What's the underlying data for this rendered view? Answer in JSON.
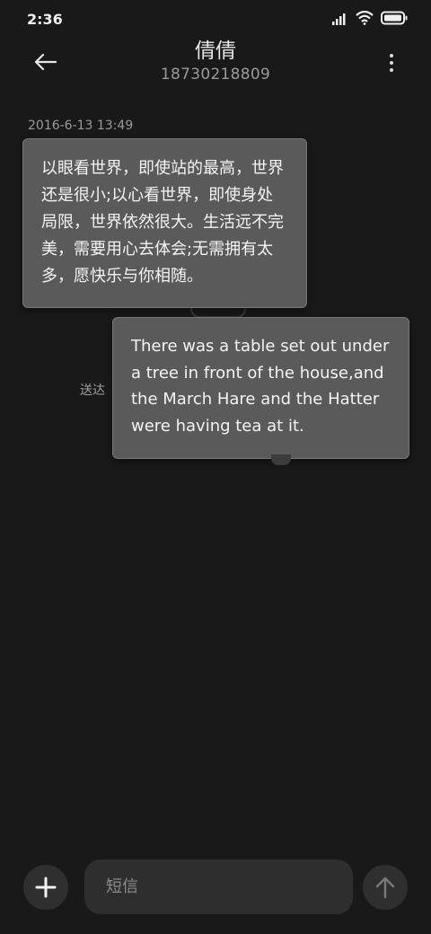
{
  "status_bar": {
    "time": "2:36",
    "icons": [
      "signal-icon",
      "wifi-icon",
      "battery-icon"
    ]
  },
  "header": {
    "contact_name": "倩倩",
    "contact_phone": "18730218809",
    "back_icon": "arrow-left-icon",
    "more_icon": "more-vertical-icon"
  },
  "conversation": {
    "timestamp": "2016-6-13 13:49",
    "messages": [
      {
        "direction": "incoming",
        "text": "以眼看世界，即使站的最高，世界还是很小;以心看世界，即使身处局限，世界依然很大。生活远不完美，需要用心去体会;无需拥有太多，愿快乐与你相随。"
      },
      {
        "direction": "outgoing",
        "text": "There was a table set out under a tree in front of the house,and the March Hare and the Hatter were having tea at it.",
        "status": "送达"
      }
    ]
  },
  "composer": {
    "placeholder": "短信",
    "add_icon": "plus-icon",
    "send_icon": "arrow-up-icon"
  },
  "colors": {
    "background": "#191919",
    "bubble": "#5a5a5a",
    "control": "#2f2f2f"
  }
}
